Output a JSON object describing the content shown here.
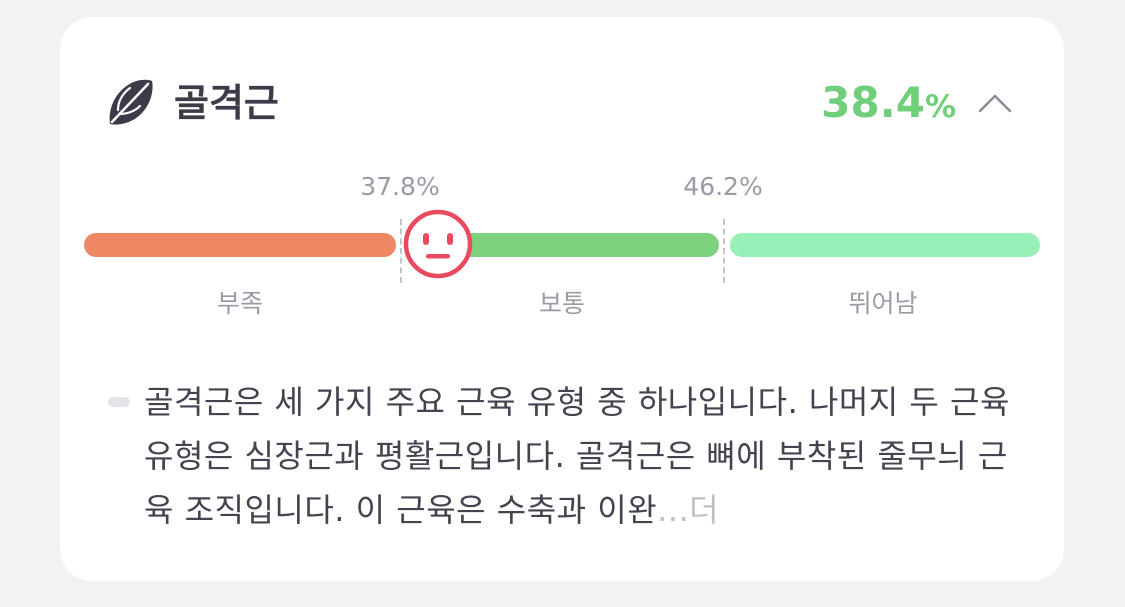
{
  "header": {
    "icon": "muscle-leaf-icon",
    "title": "골격근",
    "value": "38.4",
    "unit": "%",
    "value_color": "#6fcf7b",
    "collapse_icon": "chevron-up-icon"
  },
  "gauge": {
    "current_value": 38.4,
    "marker_icon": "neutral-face-icon",
    "marker_color": "#e84a5f",
    "thresholds": [
      "37.8%",
      "46.2%"
    ],
    "zones": [
      {
        "label": "부족",
        "color": "#ee8763"
      },
      {
        "label": "보통",
        "color": "#7fd27d"
      },
      {
        "label": "뛰어남",
        "color": "#98f0b9"
      }
    ]
  },
  "description": {
    "text": "골격근은 세 가지 주요 근육 유형 중 하나입니다. 나머지 두 근육 유형은 심장근과 평활근입니다. 골격근은 뼈에 부착된 줄무늬 근육 조직입니다. 이 근육은 수축과 이완",
    "ellipsis": "...",
    "more_label": "더"
  }
}
